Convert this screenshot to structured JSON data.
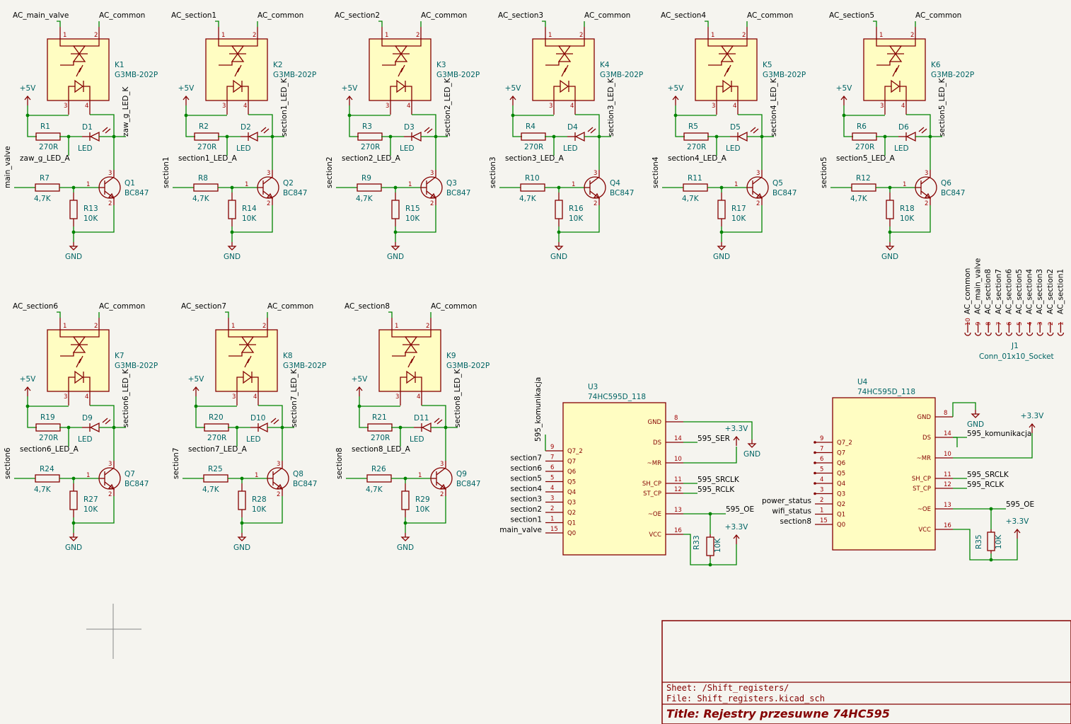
{
  "channels": [
    {
      "ac": "AC_main_valve",
      "common": "AC_common",
      "k": "K1",
      "part": "G3MB-202P",
      "pwr": "+5V",
      "r1": "R1",
      "r1v": "270R",
      "d": "D1",
      "dv": "LED",
      "ledk": "zaw_g_LED_K",
      "leda": "zaw_g_LED_A",
      "rb": "R7",
      "rbv": "4,7K",
      "ctrl": "main_valve",
      "q": "Q1",
      "qv": "BC847",
      "rp": "R13",
      "rpv": "10K",
      "gnd": "GND"
    },
    {
      "ac": "AC_section1",
      "common": "AC_common",
      "k": "K2",
      "part": "G3MB-202P",
      "pwr": "+5V",
      "r1": "R2",
      "r1v": "270R",
      "d": "D2",
      "dv": "LED",
      "ledk": "section1_LED_K",
      "leda": "section1_LED_A",
      "rb": "R8",
      "rbv": "4,7K",
      "ctrl": "section1",
      "q": "Q2",
      "qv": "BC847",
      "rp": "R14",
      "rpv": "10K",
      "gnd": "GND"
    },
    {
      "ac": "AC_section2",
      "common": "AC_common",
      "k": "K3",
      "part": "G3MB-202P",
      "pwr": "+5V",
      "r1": "R3",
      "r1v": "270R",
      "d": "D3",
      "dv": "LED",
      "ledk": "section2_LED_K",
      "leda": "section2_LED_A",
      "rb": "R9",
      "rbv": "4,7K",
      "ctrl": "section2",
      "q": "Q3",
      "qv": "BC847",
      "rp": "R15",
      "rpv": "10K",
      "gnd": "GND"
    },
    {
      "ac": "AC_section3",
      "common": "AC_common",
      "k": "K4",
      "part": "G3MB-202P",
      "pwr": "+5V",
      "r1": "R4",
      "r1v": "270R",
      "d": "D4",
      "dv": "LED",
      "ledk": "section3_LED_K",
      "leda": "section3_LED_A",
      "rb": "R10",
      "rbv": "4,7K",
      "ctrl": "section3",
      "q": "Q4",
      "qv": "BC847",
      "rp": "R16",
      "rpv": "10K",
      "gnd": "GND"
    },
    {
      "ac": "AC_section4",
      "common": "AC_common",
      "k": "K5",
      "part": "G3MB-202P",
      "pwr": "+5V",
      "r1": "R5",
      "r1v": "270R",
      "d": "D5",
      "dv": "LED",
      "ledk": "section4_LED_K",
      "leda": "section4_LED_A",
      "rb": "R11",
      "rbv": "4,7K",
      "ctrl": "section4",
      "q": "Q5",
      "qv": "BC847",
      "rp": "R17",
      "rpv": "10K",
      "gnd": "GND"
    },
    {
      "ac": "AC_section5",
      "common": "AC_common",
      "k": "K6",
      "part": "G3MB-202P",
      "pwr": "+5V",
      "r1": "R6",
      "r1v": "270R",
      "d": "D6",
      "dv": "LED",
      "ledk": "section5_LED_K",
      "leda": "section5_LED_A",
      "rb": "R12",
      "rbv": "4,7K",
      "ctrl": "section5",
      "q": "Q6",
      "qv": "BC847",
      "rp": "R18",
      "rpv": "10K",
      "gnd": "GND"
    },
    {
      "ac": "AC_section6",
      "common": "AC_common",
      "k": "K7",
      "part": "G3MB-202P",
      "pwr": "+5V",
      "r1": "R19",
      "r1v": "270R",
      "d": "D9",
      "dv": "LED",
      "ledk": "section6_LED_K",
      "leda": "section6_LED_A",
      "rb": "R24",
      "rbv": "4,7K",
      "ctrl": "section6",
      "q": "Q7",
      "qv": "BC847",
      "rp": "R27",
      "rpv": "10K",
      "gnd": "GND"
    },
    {
      "ac": "AC_section7",
      "common": "AC_common",
      "k": "K8",
      "part": "G3MB-202P",
      "pwr": "+5V",
      "r1": "R20",
      "r1v": "270R",
      "d": "D10",
      "dv": "LED",
      "ledk": "section7_LED_K",
      "leda": "section7_LED_A",
      "rb": "R25",
      "rbv": "4,7K",
      "ctrl": "section7",
      "q": "Q8",
      "qv": "BC847",
      "rp": "R28",
      "rpv": "10K",
      "gnd": "GND"
    },
    {
      "ac": "AC_section8",
      "common": "AC_common",
      "k": "K9",
      "part": "G3MB-202P",
      "pwr": "+5V",
      "r1": "R21",
      "r1v": "270R",
      "d": "D11",
      "dv": "LED",
      "ledk": "section8_LED_K",
      "leda": "section8_LED_A",
      "rb": "R26",
      "rbv": "4,7K",
      "ctrl": "section8",
      "q": "Q9",
      "qv": "BC847",
      "rp": "R29",
      "rpv": "10K",
      "gnd": "GND"
    }
  ],
  "j1": {
    "ref": "J1",
    "value": "Conn_01x10_Socket",
    "pins": [
      {
        "n": "10",
        "net": "AC_common"
      },
      {
        "n": "9",
        "net": "AC_main_valve"
      },
      {
        "n": "8",
        "net": "AC_section8"
      },
      {
        "n": "7",
        "net": "AC_section7"
      },
      {
        "n": "6",
        "net": "AC_section6"
      },
      {
        "n": "5",
        "net": "AC_section5"
      },
      {
        "n": "4",
        "net": "AC_section4"
      },
      {
        "n": "3",
        "net": "AC_section3"
      },
      {
        "n": "2",
        "net": "AC_section2"
      },
      {
        "n": "1",
        "net": "AC_section1"
      }
    ]
  },
  "u3": {
    "ref": "U3",
    "value": "74HC595D_118",
    "left": [
      {
        "pin": "9",
        "name": "Q7_2",
        "net": ""
      },
      {
        "pin": "7",
        "name": "Q7",
        "net": "section7"
      },
      {
        "pin": "6",
        "name": "Q6",
        "net": "section6"
      },
      {
        "pin": "5",
        "name": "Q5",
        "net": "section5"
      },
      {
        "pin": "4",
        "name": "Q4",
        "net": "section4"
      },
      {
        "pin": "3",
        "name": "Q3",
        "net": "section3"
      },
      {
        "pin": "2",
        "name": "Q2",
        "net": "section2"
      },
      {
        "pin": "1",
        "name": "Q1",
        "net": "section1"
      },
      {
        "pin": "15",
        "name": "Q0",
        "net": "main_valve"
      }
    ],
    "right": [
      {
        "pin": "8",
        "name": "GND",
        "net": ""
      },
      {
        "pin": "14",
        "name": "DS",
        "net": "595_SER"
      },
      {
        "pin": "10",
        "name": "~MR",
        "net": ""
      },
      {
        "pin": "11",
        "name": "SH_CP",
        "net": "595_SRCLK"
      },
      {
        "pin": "12",
        "name": "ST_CP",
        "net": "595_RCLK"
      },
      {
        "pin": "13",
        "name": "~OE",
        "net": "595_OE"
      },
      {
        "pin": "16",
        "name": "VCC",
        "net": ""
      }
    ],
    "q7s": "595_komunikacja",
    "pwr": "+3.3V",
    "pwr2": "+3.3V",
    "gnd": "GND",
    "r": "R33",
    "rv": "10K"
  },
  "u4": {
    "ref": "U4",
    "value": "74HC595D_118",
    "left": [
      {
        "pin": "9",
        "name": "Q7_2",
        "net": ""
      },
      {
        "pin": "7",
        "name": "Q7",
        "net": ""
      },
      {
        "pin": "6",
        "name": "Q6",
        "net": ""
      },
      {
        "pin": "5",
        "name": "Q5",
        "net": ""
      },
      {
        "pin": "4",
        "name": "Q4",
        "net": ""
      },
      {
        "pin": "3",
        "name": "Q3",
        "net": ""
      },
      {
        "pin": "2",
        "name": "Q2",
        "net": "power_status"
      },
      {
        "pin": "1",
        "name": "Q1",
        "net": "wifi_status"
      },
      {
        "pin": "15",
        "name": "Q0",
        "net": "section8"
      }
    ],
    "right": [
      {
        "pin": "8",
        "name": "GND",
        "net": ""
      },
      {
        "pin": "14",
        "name": "DS",
        "net": "595_komunikacja"
      },
      {
        "pin": "10",
        "name": "~MR",
        "net": ""
      },
      {
        "pin": "11",
        "name": "SH_CP",
        "net": "595_SRCLK"
      },
      {
        "pin": "12",
        "name": "ST_CP",
        "net": "595_RCLK"
      },
      {
        "pin": "13",
        "name": "~OE",
        "net": "595_OE"
      },
      {
        "pin": "16",
        "name": "VCC",
        "net": ""
      }
    ],
    "pwr": "+3.3V",
    "pwr2": "+3.3V",
    "gnd": "GND",
    "r": "R35",
    "rv": "10K"
  },
  "title_block": {
    "sheet": "Sheet: /Shift_registers/",
    "file": "File: Shift_registers.kicad_sch",
    "title": "Title: Rejestry przesuwne 74HC595"
  }
}
